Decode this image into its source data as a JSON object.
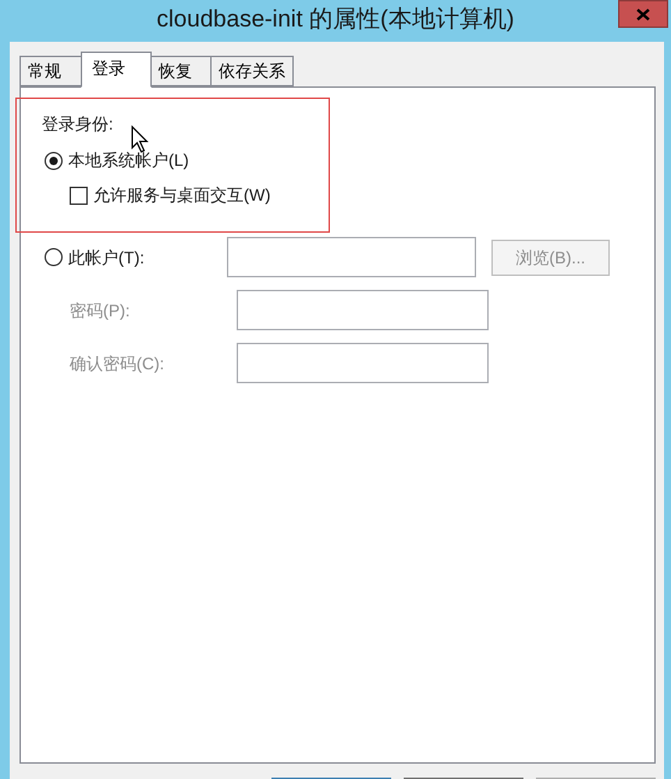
{
  "window": {
    "title": "cloudbase-init 的属性(本地计算机)"
  },
  "tabs": [
    {
      "label": "常规",
      "selected": false
    },
    {
      "label": "登录",
      "selected": true
    },
    {
      "label": "恢复",
      "selected": false
    },
    {
      "label": "依存关系",
      "selected": false
    }
  ],
  "logon": {
    "heading": "登录身份:",
    "local_system": {
      "label": "本地系统帐户(L)",
      "selected": true
    },
    "interact": {
      "label": "允许服务与桌面交互(W)",
      "checked": false
    },
    "this_account": {
      "label": "此帐户(T):",
      "selected": false
    },
    "browse_button": {
      "label": "浏览(B)...",
      "disabled": true
    },
    "fields": [
      {
        "label": "密码(P):",
        "disabled": true
      },
      {
        "label": "确认密码(C):",
        "disabled": true
      }
    ]
  }
}
